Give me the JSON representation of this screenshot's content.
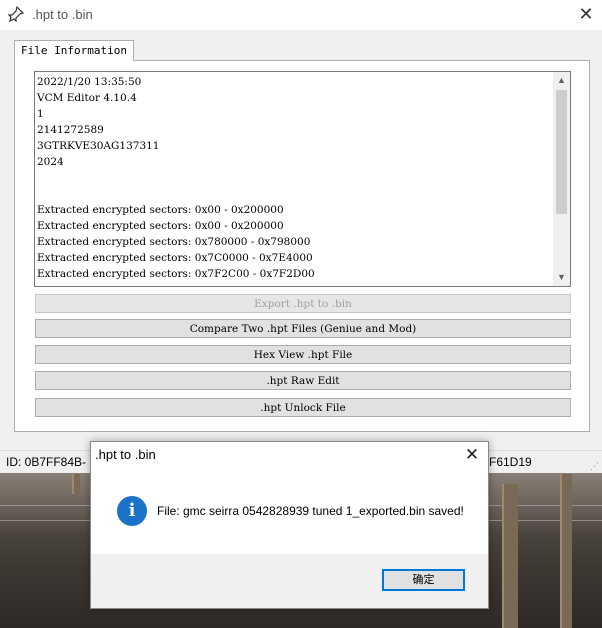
{
  "window": {
    "title": ".hpt to .bin",
    "close_glyph": "✕"
  },
  "tabs": [
    {
      "label": "File Information"
    }
  ],
  "file_info": {
    "lines": [
      "2022/1/20 13:35:50",
      "VCM Editor 4.10.4",
      "1",
      "2141272589",
      "3GTRKVE30AG137311",
      "2024",
      "",
      "",
      "Extracted encrypted sectors: 0x00 - 0x200000",
      "Extracted encrypted sectors: 0x00 - 0x200000",
      "Extracted encrypted sectors: 0x780000 - 0x798000",
      "Extracted encrypted sectors: 0x7C0000 - 0x7E4000",
      "Extracted encrypted sectors: 0x7F2C00 - 0x7F2D00"
    ]
  },
  "buttons": {
    "export": "Export .hpt to .bin",
    "compare": "Compare Two .hpt Files (Geniue and Mod)",
    "hex_view": "Hex View .hpt File",
    "raw_edit": ".hpt Raw Edit",
    "unlock": ".hpt Unlock File"
  },
  "status": {
    "id_left": "ID: 0B7FF84B-",
    "id_right": "F61D19"
  },
  "dialog": {
    "title": ".hpt to .bin",
    "close_glyph": "✕",
    "info_glyph": "i",
    "message": "File: gmc seirra 0542828939 tuned 1_exported.bin saved!",
    "ok_label": "确定"
  },
  "icons": {
    "app": "pin-icon",
    "info": "info-icon"
  },
  "colors": {
    "accent": "#0078d7",
    "info_blue": "#1a73c9"
  }
}
